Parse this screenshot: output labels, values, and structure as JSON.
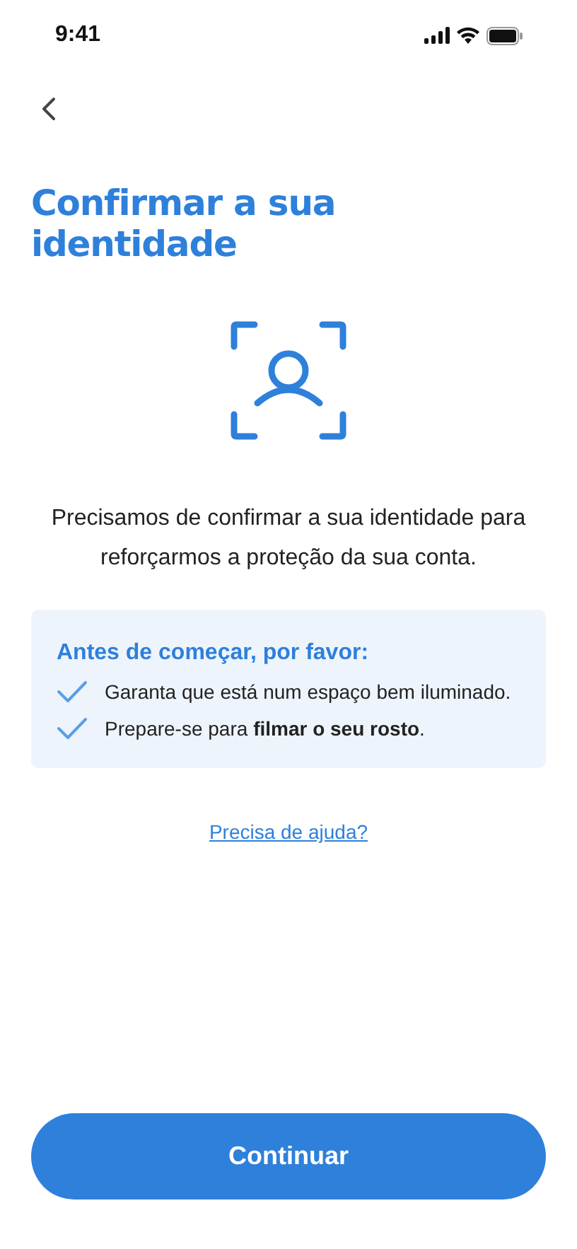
{
  "status_bar": {
    "time": "9:41"
  },
  "title": "Confirmar a sua identidade",
  "description": "Precisamos de confirmar a sua identidade para reforçarmos a proteção da sua conta.",
  "checklist": {
    "heading": "Antes de começar, por favor:",
    "items": [
      {
        "text": "Garanta que está num espaço bem iluminado."
      },
      {
        "text": "Prepare-se para **filmar o seu rosto**."
      }
    ]
  },
  "help_link": "Precisa de ajuda?",
  "button": "Continuar"
}
